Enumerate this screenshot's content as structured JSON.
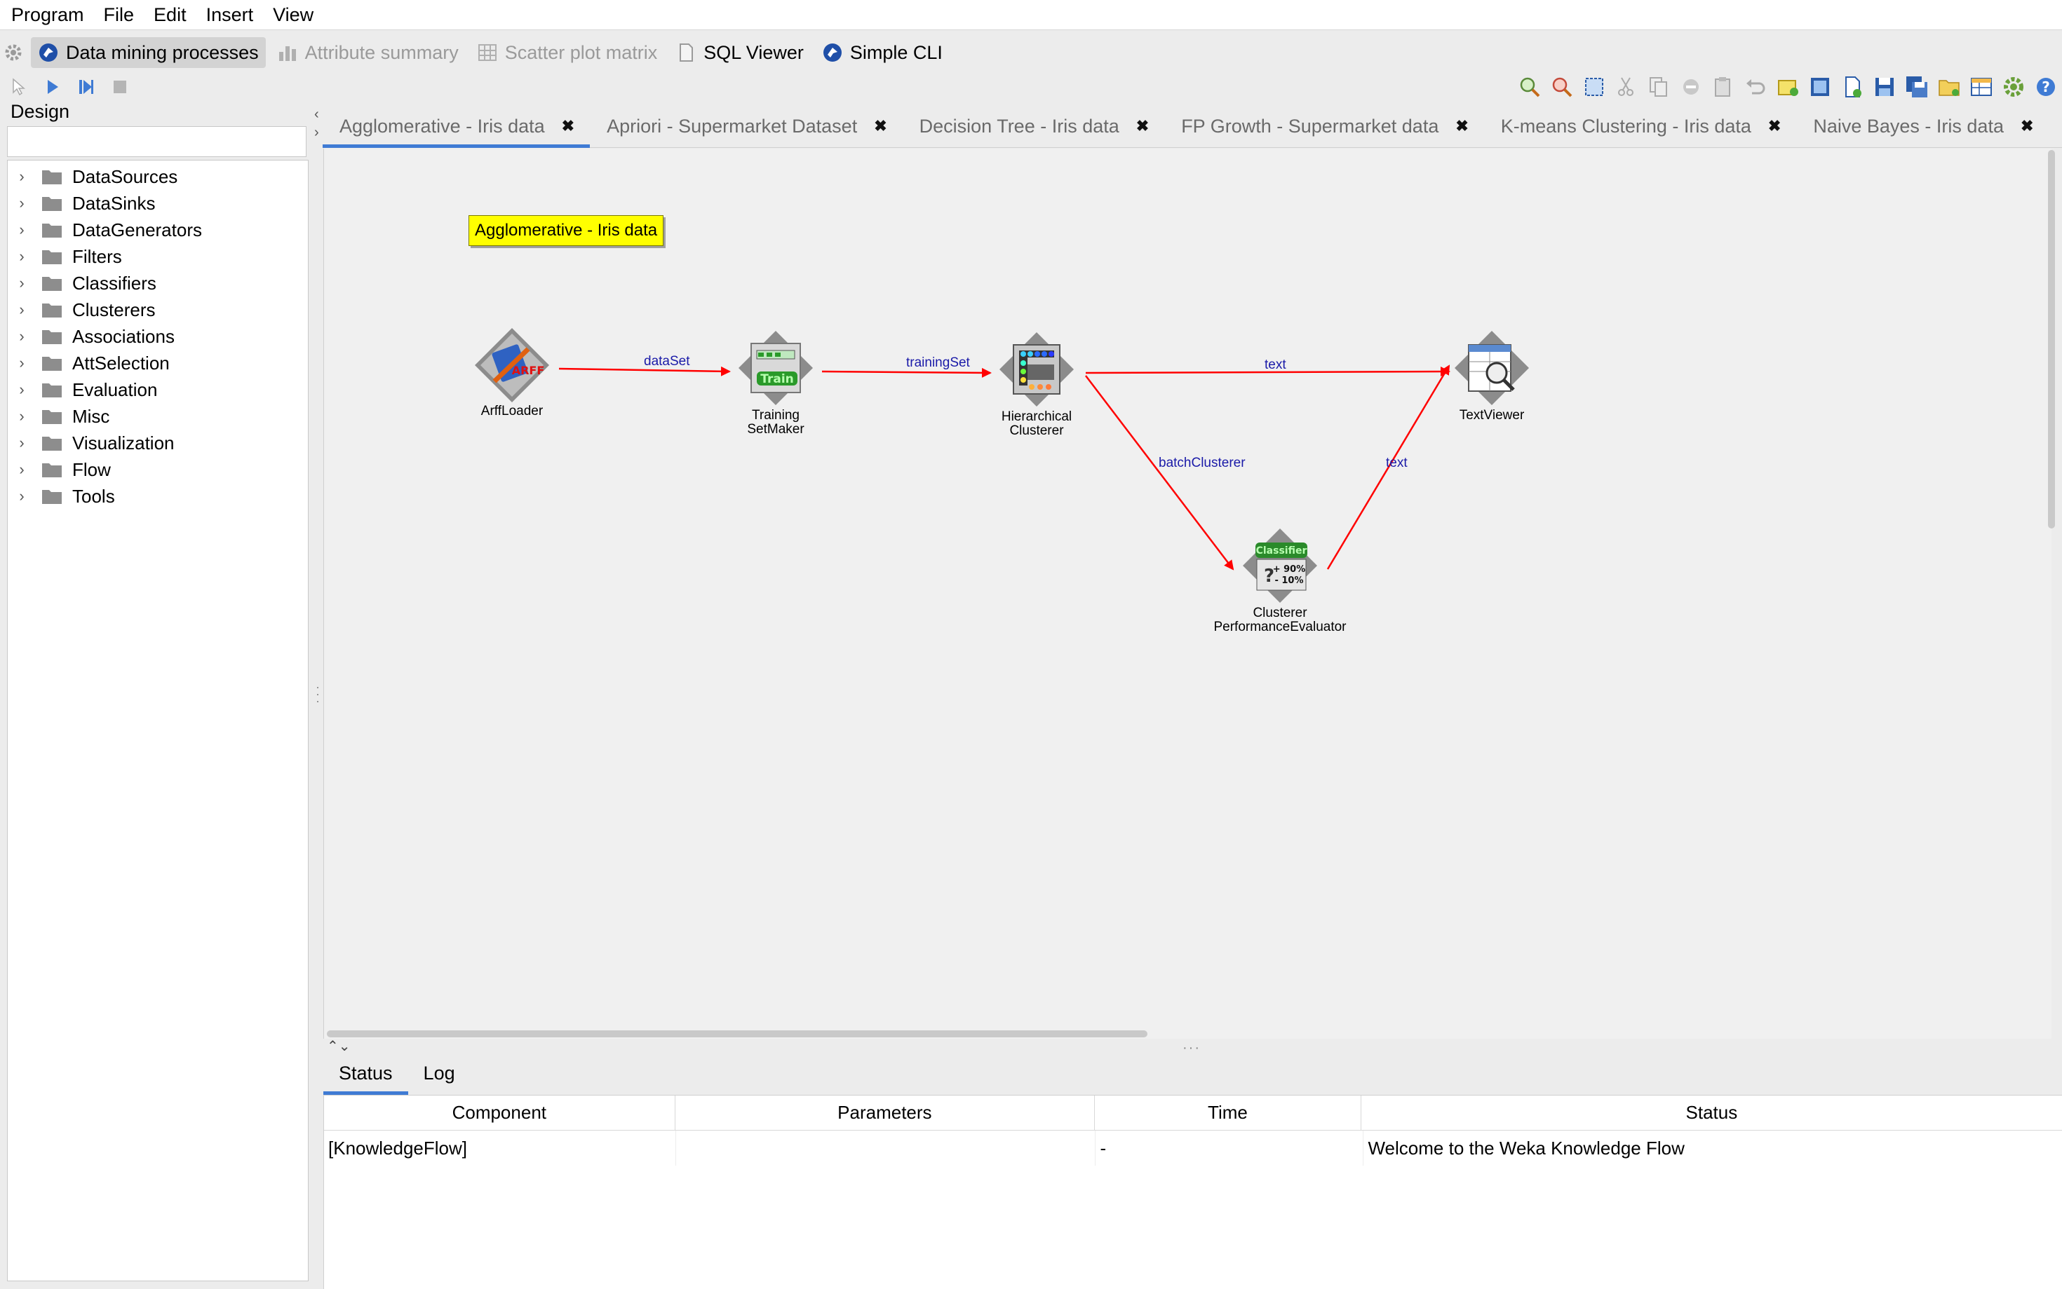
{
  "menu": [
    "Program",
    "File",
    "Edit",
    "Insert",
    "View"
  ],
  "perspectives": [
    {
      "label": "Data mining processes",
      "icon": "weka-bird-icon",
      "active": true,
      "enabled": true
    },
    {
      "label": "Attribute summary",
      "icon": "bar-chart-icon",
      "active": false,
      "enabled": false
    },
    {
      "label": "Scatter plot matrix",
      "icon": "scatter-matrix-icon",
      "active": false,
      "enabled": false
    },
    {
      "label": "SQL Viewer",
      "icon": "document-icon",
      "active": false,
      "enabled": true
    },
    {
      "label": "Simple CLI",
      "icon": "weka-bird-icon",
      "active": false,
      "enabled": true
    }
  ],
  "design": {
    "label": "Design",
    "search_value": "",
    "tree": [
      "DataSources",
      "DataSinks",
      "DataGenerators",
      "Filters",
      "Classifiers",
      "Clusterers",
      "Associations",
      "AttSelection",
      "Evaluation",
      "Misc",
      "Visualization",
      "Flow",
      "Tools"
    ]
  },
  "tabs": [
    {
      "label": "Agglomerative - Iris data",
      "active": true
    },
    {
      "label": "Apriori - Supermarket Dataset",
      "active": false
    },
    {
      "label": "Decision Tree - Iris data",
      "active": false
    },
    {
      "label": "FP Growth - Supermarket data",
      "active": false
    },
    {
      "label": "K-means Clustering - Iris data",
      "active": false
    },
    {
      "label": "Naive Bayes - Iris data",
      "active": false
    }
  ],
  "canvas": {
    "note": "Agglomerative - Iris data",
    "nodes": {
      "arff_loader": "ArffLoader",
      "training_set_maker": "Training\nSetMaker",
      "hierarchical_clusterer": "Hierarchical\nClusterer",
      "text_viewer": "TextViewer",
      "clusterer_eval": "Clusterer\nPerformanceEvaluator"
    },
    "connections": {
      "c1": "dataSet",
      "c2": "trainingSet",
      "c3": "text",
      "c4": "batchClusterer",
      "c5": "text"
    },
    "node_icon_text": {
      "arff": "ARFF",
      "train": "Train",
      "classifier": "Classifier",
      "pct_plus": "+ 90%",
      "pct_minus": "- 10%"
    }
  },
  "colors": {
    "accent": "#3f7bd4",
    "connection": "#ff0000",
    "connection_label": "#1a1aa8",
    "note": "#ffff00"
  },
  "bottom": {
    "tabs": [
      {
        "label": "Status",
        "active": true
      },
      {
        "label": "Log",
        "active": false
      }
    ],
    "columns": [
      "Component",
      "Parameters",
      "Time",
      "Status"
    ],
    "rows": [
      [
        "[KnowledgeFlow]",
        "",
        "-",
        "Welcome to the Weka Knowledge Flow"
      ]
    ]
  }
}
